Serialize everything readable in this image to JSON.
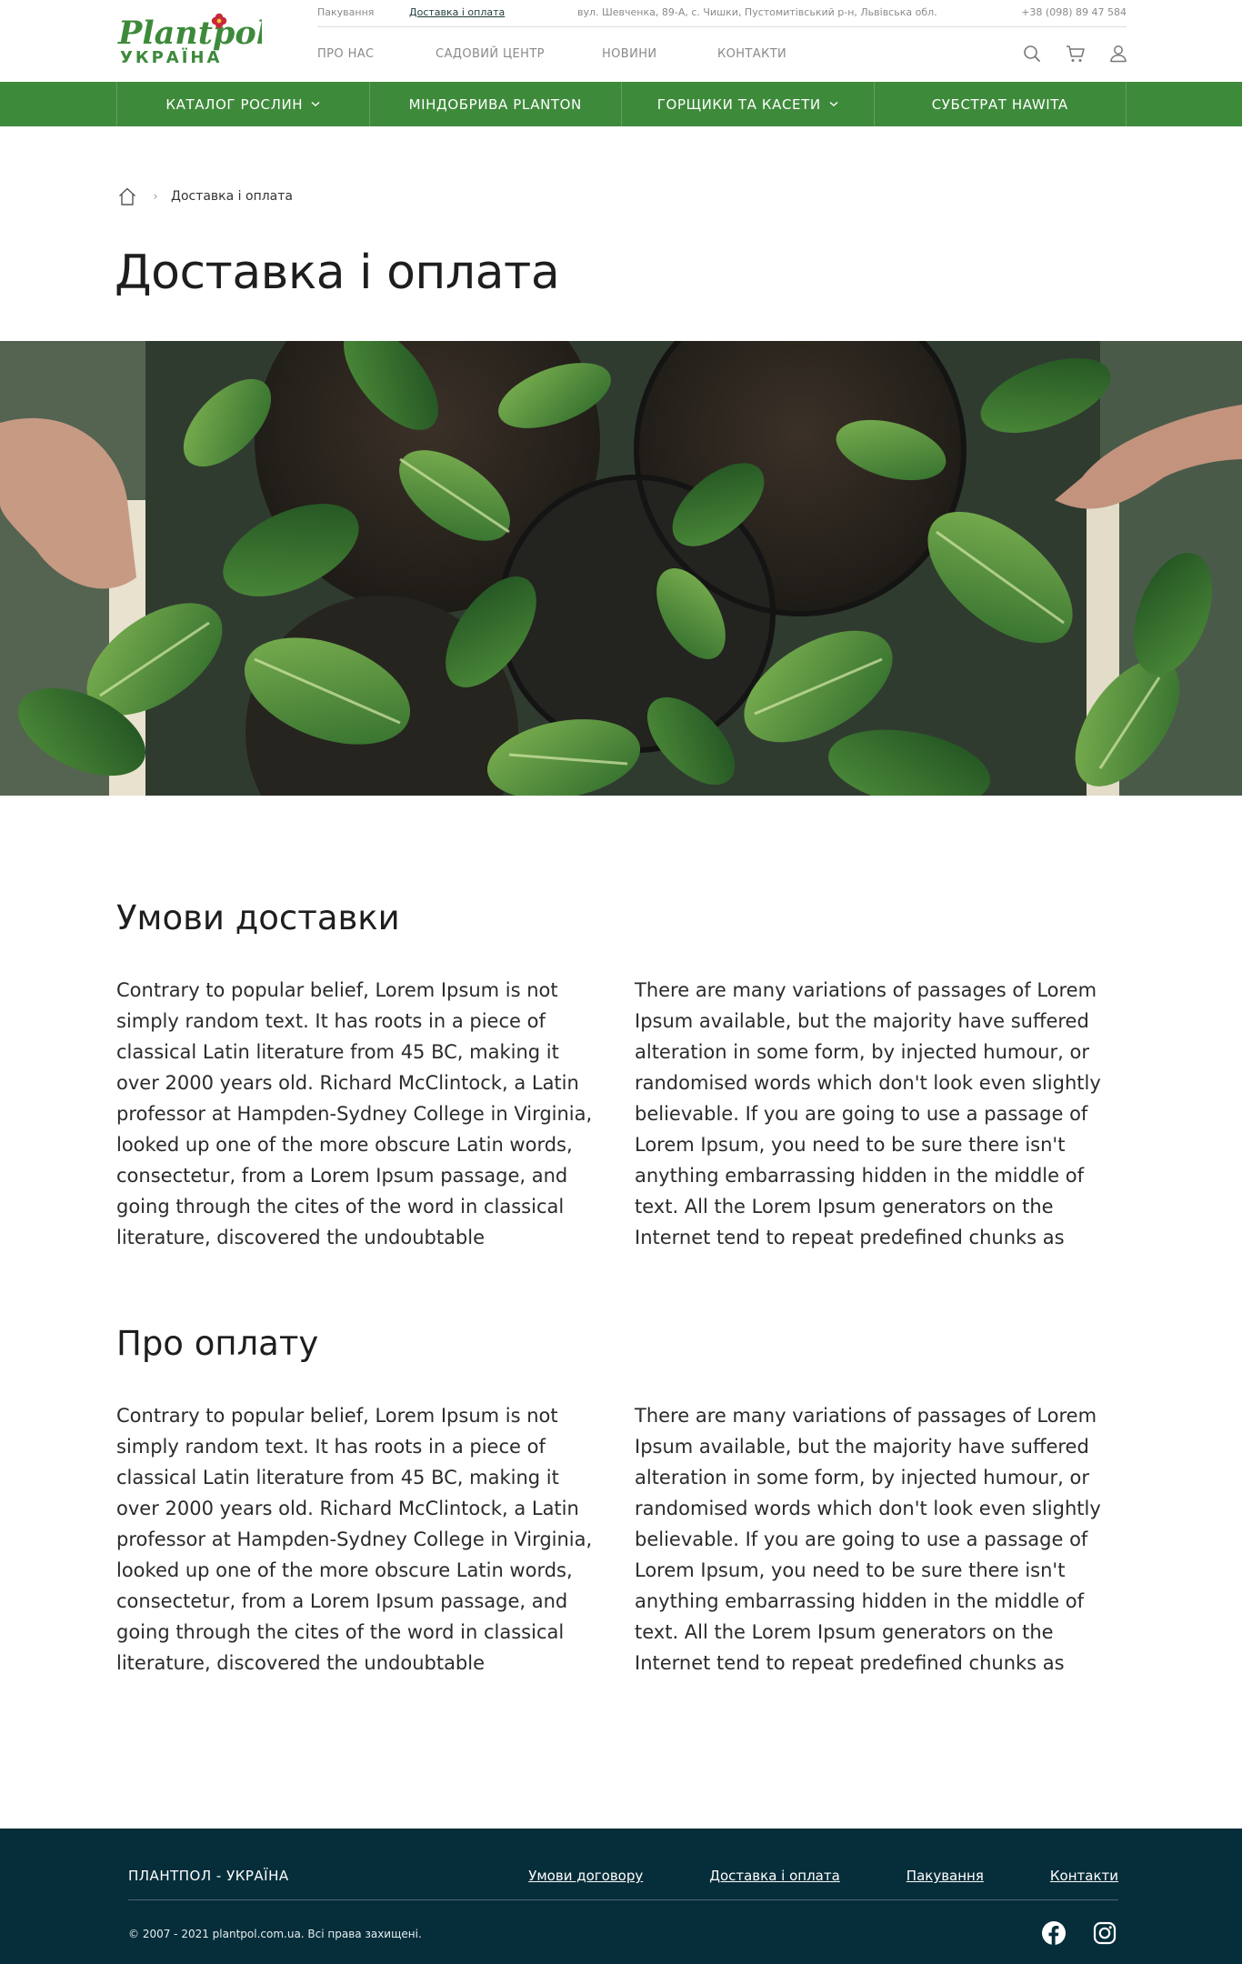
{
  "brand": {
    "logo_text": "Plantpol",
    "logo_subtext": "УКРАЇНА",
    "accent_color": "#3e8a3b",
    "footer_color": "#062d3a"
  },
  "topbar": {
    "links": [
      "Пакування",
      "Доставка і оплата"
    ],
    "address": "вул. Шевченка, 89-А, с. Чишки, Пустомитівський р-н, Львівська обл.",
    "phone": "+38 (098) 89 47 584"
  },
  "nav": {
    "items": [
      "ПРО НАС",
      "САДОВИЙ ЦЕНТР",
      "НОВИНИ",
      "КОНТАКТИ"
    ],
    "icons": [
      "search-icon",
      "cart-icon",
      "user-icon"
    ]
  },
  "categories": [
    {
      "label": "КАТАЛОГ РОСЛИН",
      "has_dropdown": true
    },
    {
      "label": "МІНДОБРИВА PLANTON",
      "has_dropdown": false
    },
    {
      "label": "ГОРЩИКИ ТА КАСЕТИ",
      "has_dropdown": true
    },
    {
      "label": "СУБСТРАТ HAWITA",
      "has_dropdown": false
    }
  ],
  "breadcrumb": {
    "separator": "›",
    "current": "Доставка і оплата"
  },
  "page": {
    "title": "Доставка і оплата"
  },
  "sections": [
    {
      "title": "Умови доставки",
      "left": "Contrary to popular belief, Lorem Ipsum is not simply random text. It has roots in a piece of classical Latin literature from 45 BC, making it over 2000 years old. Richard McClintock, a Latin professor at Hampden-Sydney College in Virginia, looked up one of the more obscure Latin words, consectetur, from a Lorem Ipsum passage, and going through the cites of the word in classical literature, discovered the undoubtable",
      "right": "There are many variations of passages of Lorem Ipsum available, but the majority have suffered alteration in some form, by injected humour, or randomised words which don't look even slightly believable. If you are going to use a passage of Lorem Ipsum, you need to be sure there isn't anything embarrassing hidden in the middle of text. All the Lorem Ipsum generators on the Internet tend to repeat predefined chunks as"
    },
    {
      "title": "Про оплату",
      "left": "Contrary to popular belief, Lorem Ipsum is not simply random text. It has roots in a piece of classical Latin literature from 45 BC, making it over 2000 years old. Richard McClintock, a Latin professor at Hampden-Sydney College in Virginia, looked up one of the more obscure Latin words, consectetur, from a Lorem Ipsum passage, and going through the cites of the word in classical literature, discovered the undoubtable",
      "right": "There are many variations of passages of Lorem Ipsum available, but the majority have suffered alteration in some form, by injected humour, or randomised words which don't look even slightly believable. If you are going to use a passage of Lorem Ipsum, you need to be sure there isn't anything embarrassing hidden in the middle of text. All the Lorem Ipsum generators on the Internet tend to repeat predefined chunks as"
    }
  ],
  "footer": {
    "brand": "ПЛАНТПОЛ - УКРАЇНА",
    "links": [
      "Умови договору",
      "Доставка і оплата",
      "Пакування",
      "Контакти"
    ],
    "copyright": "© 2007 - 2021 plantpol.com.ua. Всі права захищені.",
    "social_icons": [
      "facebook-icon",
      "instagram-icon"
    ]
  }
}
